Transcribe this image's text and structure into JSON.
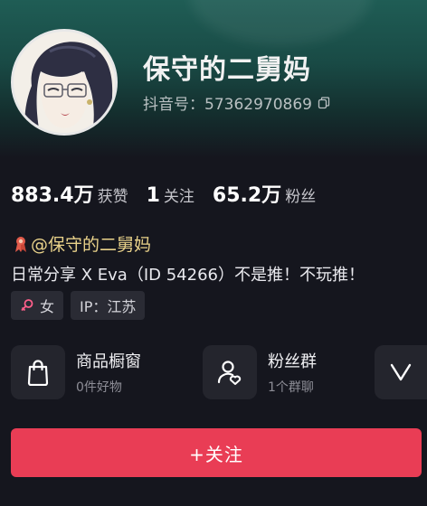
{
  "profile": {
    "username": "保守的二舅妈",
    "douyin_id_label": "抖音号：57362970869"
  },
  "stats": [
    {
      "value": "883.4万",
      "label": "获赞"
    },
    {
      "value": "1",
      "label": "关注"
    },
    {
      "value": "65.2万",
      "label": "粉丝"
    }
  ],
  "bio": {
    "mention": "@保守的二舅妈",
    "text": "日常分享  X Eva（ID 54266）不是推！不玩推！"
  },
  "tags": {
    "gender": "女",
    "ip": "IP：江苏"
  },
  "cards": [
    {
      "title": "商品橱窗",
      "sub": "0件好物",
      "icon": "shopping-bag-icon"
    },
    {
      "title": "粉丝群",
      "sub": "1个群聊",
      "icon": "group-heart-icon"
    }
  ],
  "follow_label": "+关注",
  "colors": {
    "accent": "#e93d55",
    "background": "#15161e",
    "header": "#1f5d55",
    "mention": "#e9d28a"
  }
}
